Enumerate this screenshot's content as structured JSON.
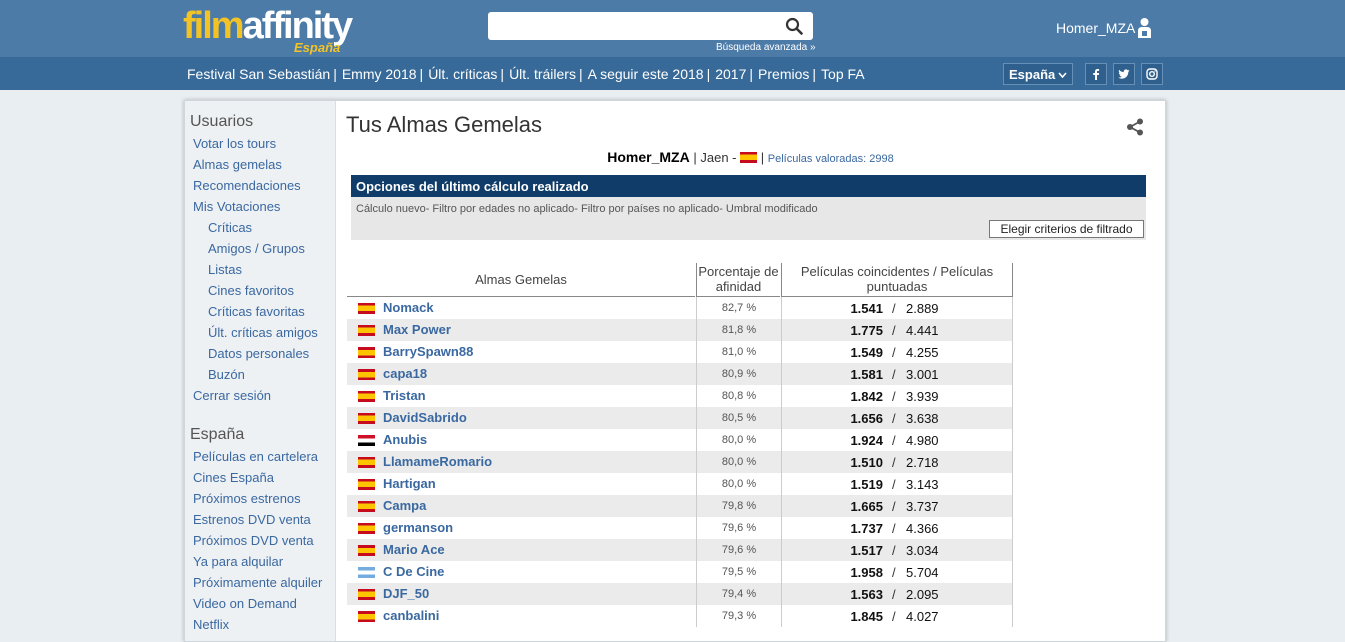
{
  "header": {
    "logo_film": "film",
    "logo_affinity": "affinity",
    "logo_region": "España",
    "search_placeholder": "",
    "advanced_search": "Búsqueda avanzada »",
    "username": "Homer_MZA"
  },
  "nav": {
    "links": [
      "Festival San Sebastián",
      "Emmy 2018",
      "Últ. críticas",
      "Últ. tráilers",
      "A seguir este 2018",
      "2017",
      "Premios",
      "Top FA"
    ],
    "country": "España"
  },
  "sidebar": {
    "section1_title": "Usuarios",
    "section1_items": [
      {
        "label": "Votar los tours",
        "indent": 0
      },
      {
        "label": "Almas gemelas",
        "indent": 0
      },
      {
        "label": "Recomendaciones",
        "indent": 0
      },
      {
        "label": "Mis Votaciones",
        "indent": 0
      },
      {
        "label": "Críticas",
        "indent": 1
      },
      {
        "label": "Amigos / Grupos",
        "indent": 1
      },
      {
        "label": "Listas",
        "indent": 1
      },
      {
        "label": "Cines favoritos",
        "indent": 1
      },
      {
        "label": "Críticas favoritas",
        "indent": 1
      },
      {
        "label": "Últ. críticas amigos",
        "indent": 1
      },
      {
        "label": "Datos personales",
        "indent": 1
      },
      {
        "label": "Buzón",
        "indent": 1
      },
      {
        "label": "Cerrar sesión",
        "indent": 0
      }
    ],
    "section2_title": "España",
    "section2_items": [
      "Películas en cartelera",
      "Cines España",
      "Próximos estrenos",
      "Estrenos DVD venta",
      "Próximos DVD venta",
      "Ya para alquilar",
      "Próximamente alquiler",
      "Video on Demand",
      "Netflix"
    ]
  },
  "main": {
    "title": "Tus Almas Gemelas",
    "user": {
      "name": "Homer_MZA",
      "location": "Jaen -",
      "rated_label": "Películas valoradas: 2998"
    },
    "options": {
      "heading": "Opciones del último cálculo realizado",
      "description": "Cálculo nuevo- Filtro por edades no aplicado- Filtro por países no aplicado- Umbral modificado",
      "button": "Elegir criterios de filtrado"
    },
    "table": {
      "col_name": "Almas Gemelas",
      "col_pct": "Porcentaje de afinidad",
      "col_movies": "Películas coincidentes / Películas puntuadas",
      "rows": [
        {
          "flag": "es",
          "name": "Nomack",
          "pct": "82,7 %",
          "common": "1.541",
          "rated": "2.889"
        },
        {
          "flag": "es",
          "name": "Max Power",
          "pct": "81,8 %",
          "common": "1.775",
          "rated": "4.441"
        },
        {
          "flag": "es",
          "name": "BarrySpawn88",
          "pct": "81,0 %",
          "common": "1.549",
          "rated": "4.255"
        },
        {
          "flag": "es",
          "name": "capa18",
          "pct": "80,9 %",
          "common": "1.581",
          "rated": "3.001"
        },
        {
          "flag": "es",
          "name": "Tristan",
          "pct": "80,8 %",
          "common": "1.842",
          "rated": "3.939"
        },
        {
          "flag": "es",
          "name": "DavidSabrido",
          "pct": "80,5 %",
          "common": "1.656",
          "rated": "3.638"
        },
        {
          "flag": "eg",
          "name": "Anubis",
          "pct": "80,0 %",
          "common": "1.924",
          "rated": "4.980"
        },
        {
          "flag": "es",
          "name": "LlamameRomario",
          "pct": "80,0 %",
          "common": "1.510",
          "rated": "2.718"
        },
        {
          "flag": "es",
          "name": "Hartigan",
          "pct": "80,0 %",
          "common": "1.519",
          "rated": "3.143"
        },
        {
          "flag": "es",
          "name": "Campa",
          "pct": "79,8 %",
          "common": "1.665",
          "rated": "3.737"
        },
        {
          "flag": "es",
          "name": "germanson",
          "pct": "79,6 %",
          "common": "1.737",
          "rated": "4.366"
        },
        {
          "flag": "es",
          "name": "Mario Ace",
          "pct": "79,6 %",
          "common": "1.517",
          "rated": "3.034"
        },
        {
          "flag": "ar",
          "name": "C De Cine",
          "pct": "79,5 %",
          "common": "1.958",
          "rated": "5.704"
        },
        {
          "flag": "es",
          "name": "DJF_50",
          "pct": "79,4 %",
          "common": "1.563",
          "rated": "2.095"
        },
        {
          "flag": "es",
          "name": "canbalini",
          "pct": "79,3 %",
          "common": "1.845",
          "rated": "4.027"
        }
      ]
    }
  },
  "colors": {
    "header": "#4c7ba8",
    "navbar": "#376a98",
    "logo_yellow": "#f3c326",
    "link": "#3a68a0",
    "options_header": "#0f3c68"
  },
  "icons": [
    "search-icon",
    "user-icon",
    "chevron-down-icon",
    "facebook-icon",
    "twitter-icon",
    "instagram-icon",
    "share-icon"
  ]
}
